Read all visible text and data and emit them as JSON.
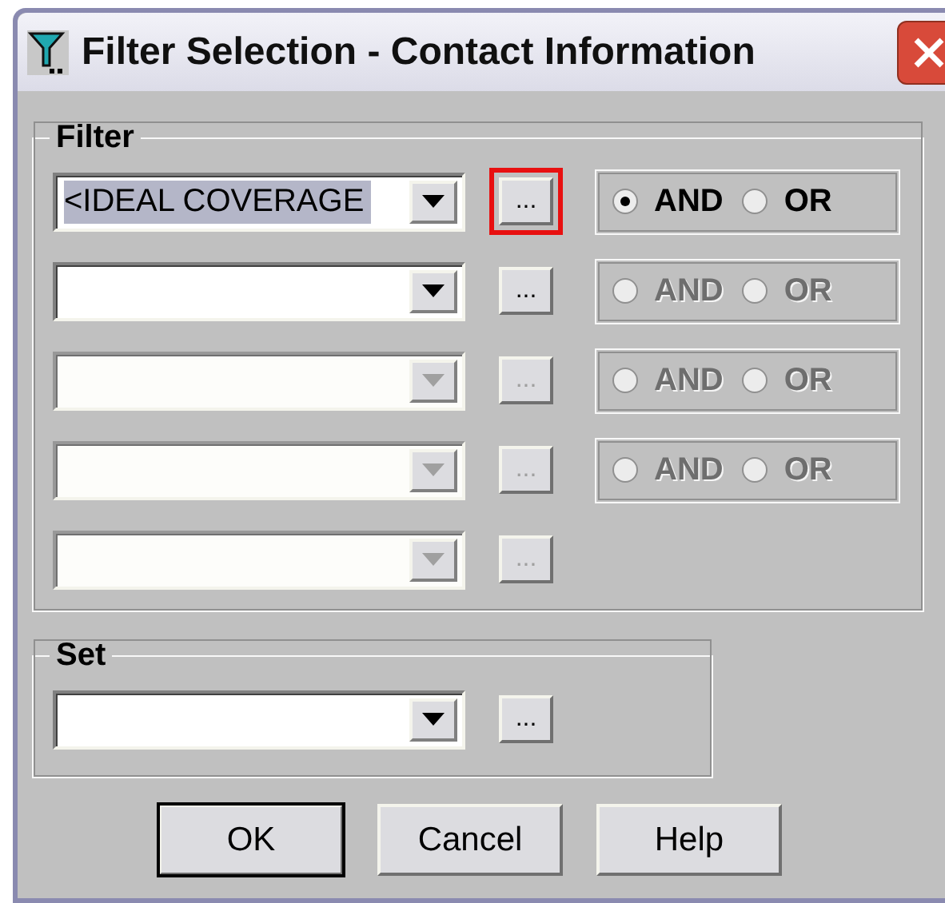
{
  "window": {
    "title": "Filter Selection - Contact Information"
  },
  "filter": {
    "legend": "Filter",
    "rows": [
      {
        "value": "<IDEAL COVERAGE",
        "value_selected": true,
        "combo_disabled": false,
        "button": {
          "label": "...",
          "disabled": false,
          "highlighted": true
        },
        "logic": {
          "disabled": false,
          "options": [
            {
              "label": "AND",
              "selected": true
            },
            {
              "label": "OR",
              "selected": false
            }
          ]
        }
      },
      {
        "combo_disabled": false,
        "button": {
          "label": "...",
          "disabled": false,
          "highlighted": false
        },
        "logic": {
          "disabled": true,
          "options": [
            {
              "label": "AND",
              "selected": false
            },
            {
              "label": "OR",
              "selected": false
            }
          ]
        }
      },
      {
        "combo_disabled": true,
        "button": {
          "label": "...",
          "disabled": true,
          "highlighted": false
        },
        "logic": {
          "disabled": true,
          "options": [
            {
              "label": "AND",
              "selected": false
            },
            {
              "label": "OR",
              "selected": false
            }
          ]
        }
      },
      {
        "combo_disabled": true,
        "button": {
          "label": "...",
          "disabled": true,
          "highlighted": false
        },
        "logic": {
          "disabled": true,
          "options": [
            {
              "label": "AND",
              "selected": false
            },
            {
              "label": "OR",
              "selected": false
            }
          ]
        }
      },
      {
        "combo_disabled": true,
        "button": {
          "label": "...",
          "disabled": true,
          "highlighted": false
        }
      }
    ]
  },
  "set": {
    "legend": "Set",
    "combo_disabled": false,
    "button": {
      "label": "...",
      "disabled": false,
      "highlighted": false
    }
  },
  "buttons": [
    {
      "label": "OK",
      "default": true
    },
    {
      "label": "Cancel",
      "default": false
    },
    {
      "label": "Help",
      "default": false
    }
  ]
}
